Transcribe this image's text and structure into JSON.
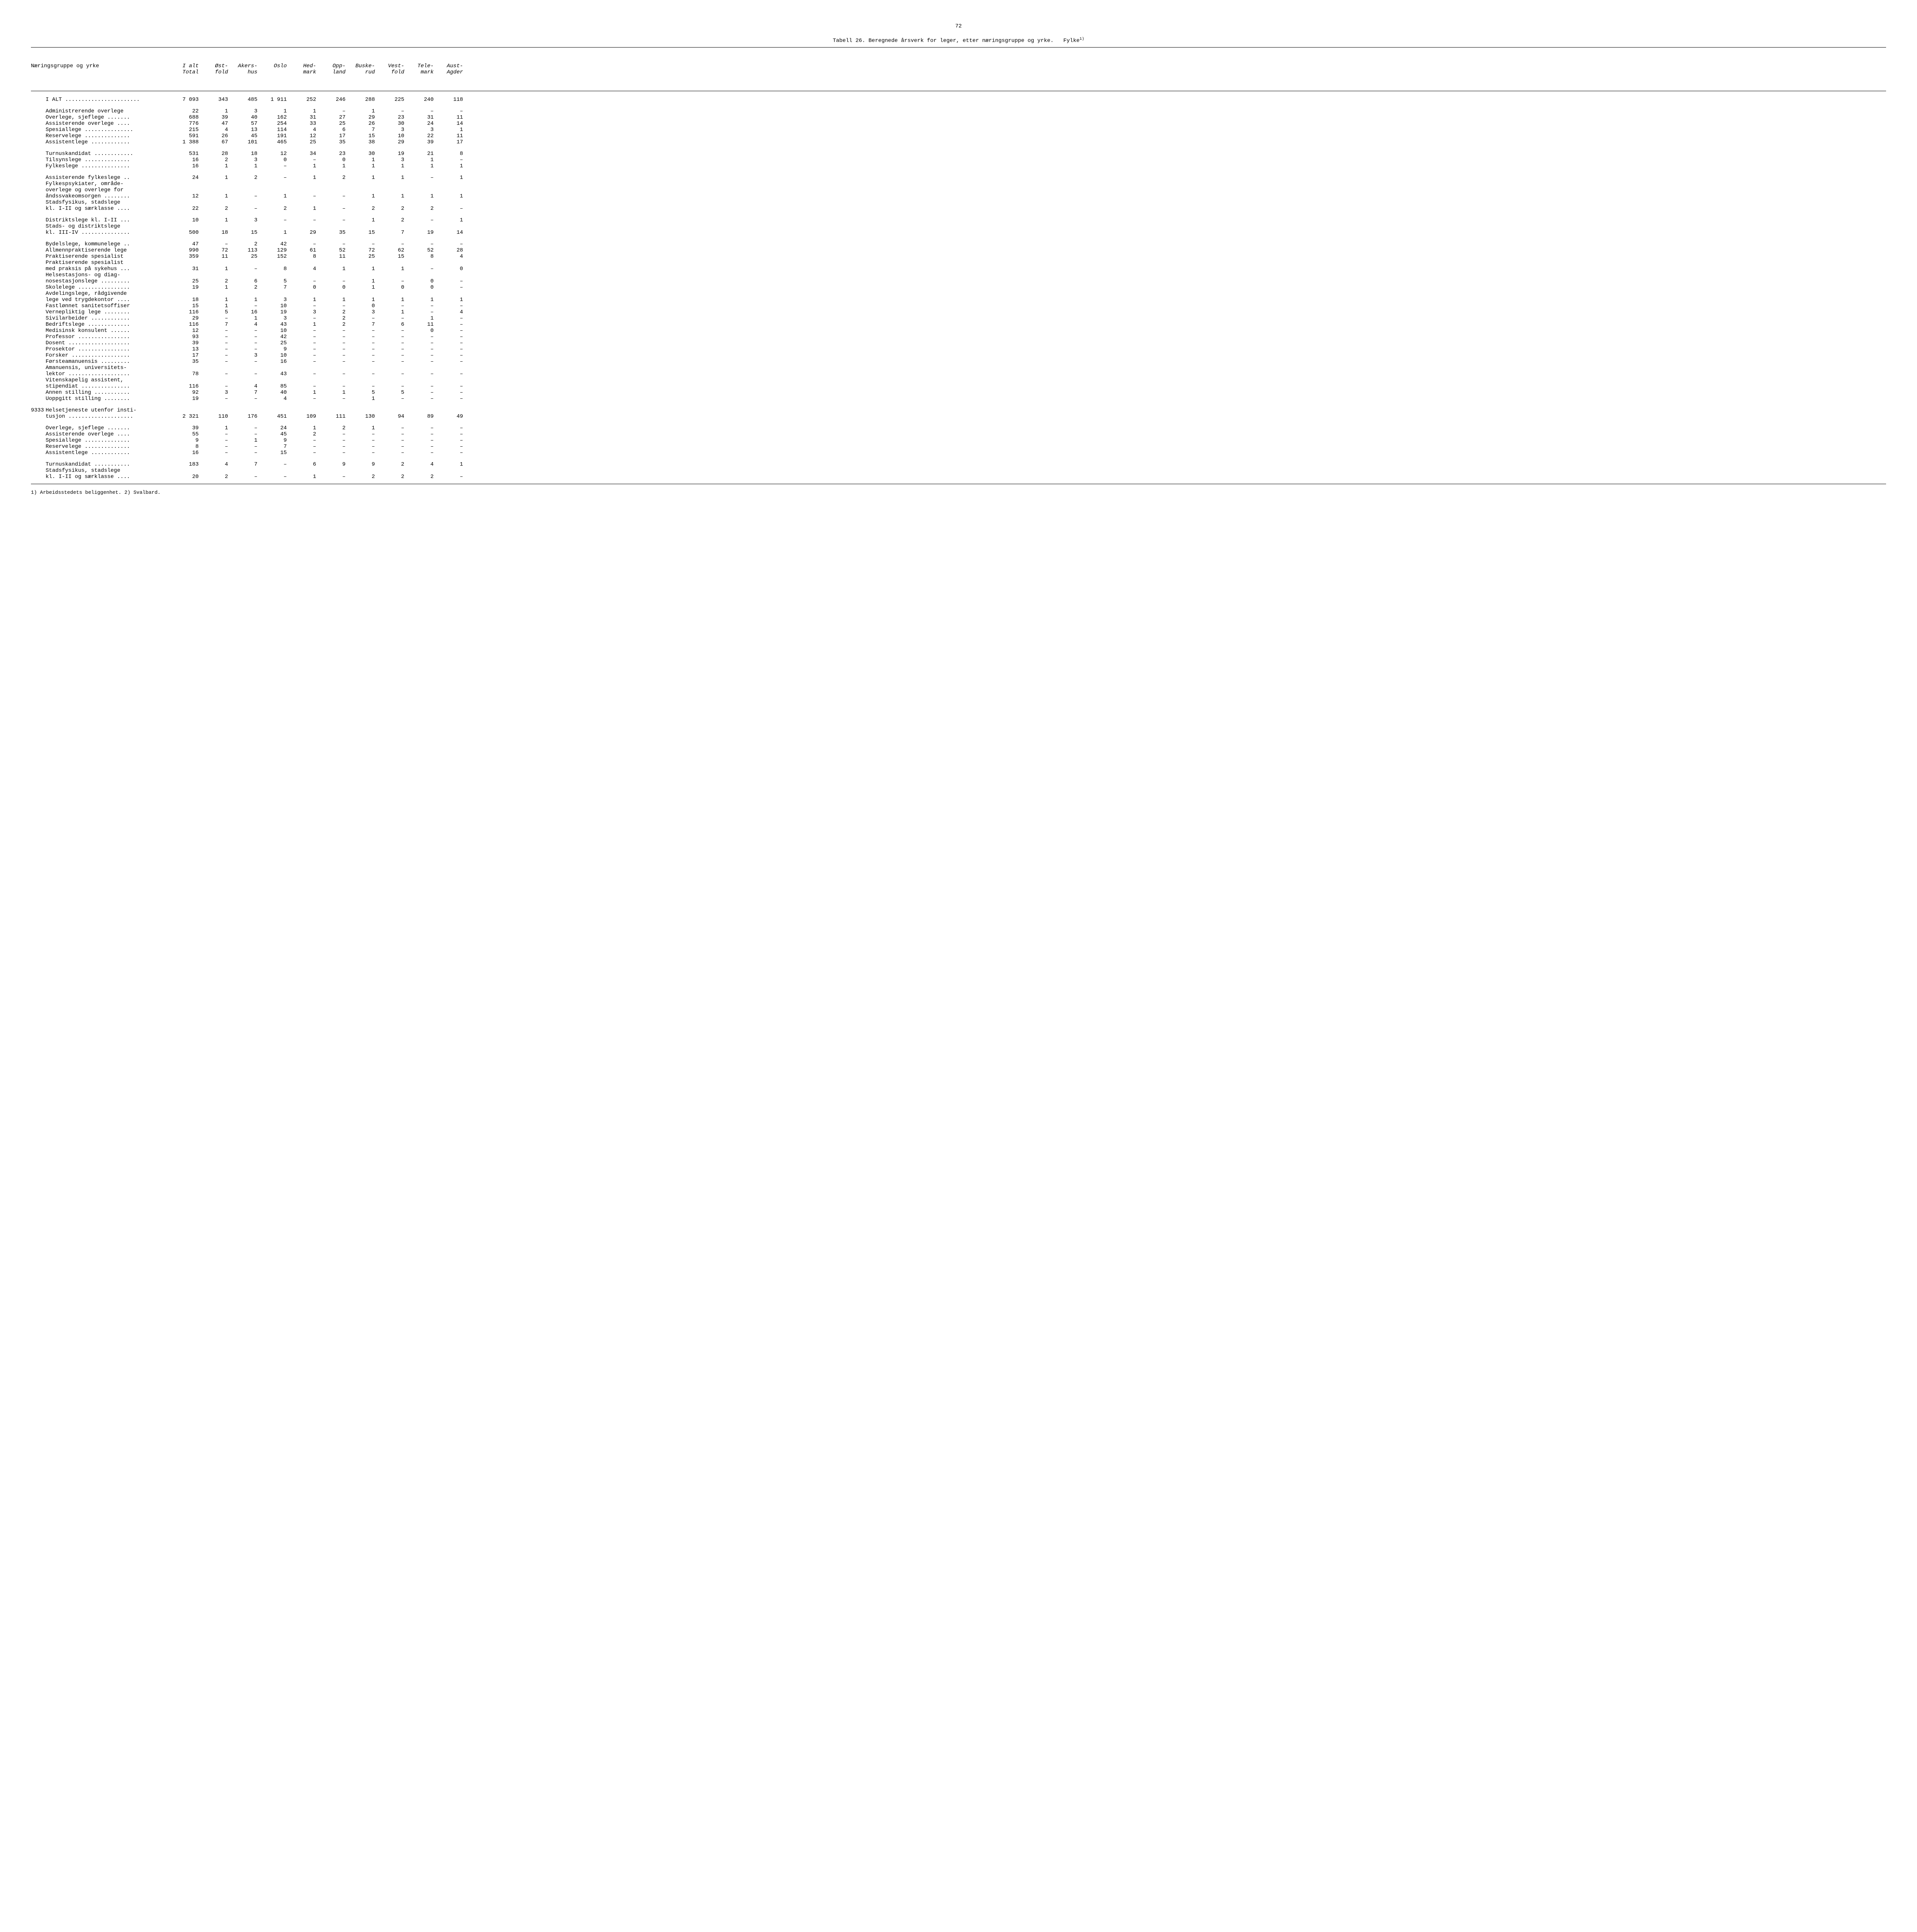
{
  "page_number": "72",
  "table_caption_prefix": "Tabell 26.",
  "table_caption": "Beregnede årsverk for leger, etter næringsgruppe og yrke.",
  "table_caption_suffix": "Fylke",
  "table_caption_sup": "1)",
  "head_label": "Næringsgruppe og yrke",
  "columns": [
    "I alt\nTotal",
    "Øst-\nfold",
    "Akers-\nhus",
    "Oslo",
    "Hed-\nmark",
    "Opp-\nland",
    "Buske-\nrud",
    "Vest-\nfold",
    "Tele-\nmark",
    "Aust-\nAgder"
  ],
  "footnote": "1)  Arbeidsstedets beliggenhet.  2)  Svalbard.",
  "rows": [
    {
      "type": "data",
      "code": "",
      "label": "I ALT .......................",
      "v": [
        "7 093",
        "343",
        "485",
        "1 911",
        "252",
        "246",
        "288",
        "225",
        "240",
        "118"
      ]
    },
    {
      "type": "spacer"
    },
    {
      "type": "data",
      "code": "",
      "label": "Administrerende overlege",
      "v": [
        "22",
        "1",
        "3",
        "1",
        "1",
        "–",
        "1",
        "–",
        "–",
        "–"
      ]
    },
    {
      "type": "data",
      "code": "",
      "label": "Overlege, sjeflege .......",
      "v": [
        "688",
        "39",
        "40",
        "162",
        "31",
        "27",
        "29",
        "23",
        "31",
        "11"
      ]
    },
    {
      "type": "data",
      "code": "",
      "label": "Assisterende overlege ....",
      "v": [
        "776",
        "47",
        "57",
        "254",
        "33",
        "25",
        "26",
        "30",
        "24",
        "14"
      ]
    },
    {
      "type": "data",
      "code": "",
      "label": "Spesiallege ...............",
      "v": [
        "215",
        "4",
        "13",
        "114",
        "4",
        "6",
        "7",
        "3",
        "3",
        "1"
      ]
    },
    {
      "type": "data",
      "code": "",
      "label": "Reservelege ..............",
      "v": [
        "591",
        "26",
        "45",
        "191",
        "12",
        "17",
        "15",
        "10",
        "22",
        "11"
      ]
    },
    {
      "type": "data",
      "code": "",
      "label": "Assistentlege ............",
      "v": [
        "1 388",
        "67",
        "101",
        "465",
        "25",
        "35",
        "38",
        "29",
        "39",
        "17"
      ]
    },
    {
      "type": "spacer"
    },
    {
      "type": "data",
      "code": "",
      "label": "Turnuskandidat ............",
      "v": [
        "531",
        "28",
        "18",
        "12",
        "34",
        "23",
        "30",
        "19",
        "21",
        "8"
      ]
    },
    {
      "type": "data",
      "code": "",
      "label": "Tilsynslege ..............",
      "v": [
        "16",
        "2",
        "3",
        "0",
        "–",
        "0",
        "1",
        "3",
        "1",
        "–"
      ]
    },
    {
      "type": "data",
      "code": "",
      "label": "Fylkeslege ...............",
      "v": [
        "16",
        "1",
        "1",
        "–",
        "1",
        "1",
        "1",
        "1",
        "1",
        "1"
      ]
    },
    {
      "type": "spacer"
    },
    {
      "type": "data",
      "code": "",
      "label": "Assisterende fylkeslege ..",
      "v": [
        "24",
        "1",
        "2",
        "–",
        "1",
        "2",
        "1",
        "1",
        "–",
        "1"
      ]
    },
    {
      "type": "label",
      "code": "",
      "label": "Fylkespsykiater, område-"
    },
    {
      "type": "label",
      "code": "",
      "label": "overlege og overlege for"
    },
    {
      "type": "data",
      "code": "",
      "label": "åndssvakeomsorgen ........",
      "v": [
        "12",
        "1",
        "–",
        "1",
        "–",
        "–",
        "1",
        "1",
        "1",
        "1"
      ]
    },
    {
      "type": "label",
      "code": "",
      "label": "Stadsfysikus, stadslege"
    },
    {
      "type": "data",
      "code": "",
      "label": "kl. I-II og særklasse ....",
      "v": [
        "22",
        "2",
        "–",
        "2",
        "1",
        "–",
        "2",
        "2",
        "2",
        "–"
      ]
    },
    {
      "type": "spacer"
    },
    {
      "type": "data",
      "code": "",
      "label": "Distriktslege kl. I-II ...",
      "v": [
        "10",
        "1",
        "3",
        "–",
        "–",
        "–",
        "1",
        "2",
        "–",
        "1"
      ]
    },
    {
      "type": "label",
      "code": "",
      "label": "Stads- og distriktslege"
    },
    {
      "type": "data",
      "code": "",
      "label": "kl. III-IV ...............",
      "v": [
        "500",
        "18",
        "15",
        "1",
        "29",
        "35",
        "15",
        "7",
        "19",
        "14"
      ]
    },
    {
      "type": "spacer"
    },
    {
      "type": "data",
      "code": "",
      "label": "Bydelslege, kommunelege ..",
      "v": [
        "47",
        "–",
        "2",
        "42",
        "–",
        "–",
        "–",
        "–",
        "–",
        "–"
      ]
    },
    {
      "type": "data",
      "code": "",
      "label": "Allmennpraktiserende lege",
      "v": [
        "990",
        "72",
        "113",
        "129",
        "61",
        "52",
        "72",
        "62",
        "52",
        "28"
      ]
    },
    {
      "type": "data",
      "code": "",
      "label": "Praktiserende spesialist",
      "v": [
        "359",
        "11",
        "25",
        "152",
        "8",
        "11",
        "25",
        "15",
        "8",
        "4"
      ]
    },
    {
      "type": "label",
      "code": "",
      "label": "Praktiserende spesialist"
    },
    {
      "type": "data",
      "code": "",
      "label": "med praksis på sykehus ...",
      "v": [
        "31",
        "1",
        "–",
        "8",
        "4",
        "1",
        "1",
        "1",
        "–",
        "0"
      ]
    },
    {
      "type": "label",
      "code": "",
      "label": "Helsestasjons- og diag-"
    },
    {
      "type": "data",
      "code": "",
      "label": "nosestasjon­slege .........",
      "v": [
        "25",
        "2",
        "6",
        "5",
        "–",
        "–",
        "1",
        "–",
        "0",
        "–"
      ]
    },
    {
      "type": "data",
      "code": "",
      "label": "Skolelege ................",
      "v": [
        "19",
        "1",
        "2",
        "7",
        "0",
        "0",
        "1",
        "0",
        "0",
        "–"
      ]
    },
    {
      "type": "label",
      "code": "",
      "label": "Avdelingslege, rådgivende"
    },
    {
      "type": "data",
      "code": "",
      "label": "lege ved trygdekontor ....",
      "v": [
        "18",
        "1",
        "1",
        "3",
        "1",
        "1",
        "1",
        "1",
        "1",
        "1"
      ]
    },
    {
      "type": "data",
      "code": "",
      "label": "Fastlønnet sanitetsoffiser",
      "v": [
        "15",
        "1",
        "–",
        "10",
        "–",
        "–",
        "0",
        "–",
        "–",
        "–"
      ]
    },
    {
      "type": "data",
      "code": "",
      "label": "Vernepliktig lege ........",
      "v": [
        "116",
        "5",
        "16",
        "19",
        "3",
        "2",
        "3",
        "1",
        "–",
        "4"
      ]
    },
    {
      "type": "data",
      "code": "",
      "label": "Sivilarbeider ............",
      "v": [
        "29",
        "–",
        "1",
        "3",
        "–",
        "2",
        "–",
        "–",
        "1",
        "–"
      ]
    },
    {
      "type": "data",
      "code": "",
      "label": "Bedriftslege .............",
      "v": [
        "116",
        "7",
        "4",
        "43",
        "1",
        "2",
        "7",
        "6",
        "11",
        "–"
      ]
    },
    {
      "type": "data",
      "code": "",
      "label": "Medisinsk konsulent ......",
      "v": [
        "12",
        "–",
        "–",
        "10",
        "–",
        "–",
        "–",
        "–",
        "0",
        "–"
      ]
    },
    {
      "type": "data",
      "code": "",
      "label": "Professor ................",
      "v": [
        "93",
        "–",
        "–",
        "42",
        "–",
        "–",
        "–",
        "–",
        "–",
        "–"
      ]
    },
    {
      "type": "data",
      "code": "",
      "label": "Dosent ...................",
      "v": [
        "39",
        "–",
        "–",
        "25",
        "–",
        "–",
        "–",
        "–",
        "–",
        "–"
      ]
    },
    {
      "type": "data",
      "code": "",
      "label": "Prosektor ................",
      "v": [
        "13",
        "–",
        "–",
        "9",
        "–",
        "–",
        "–",
        "–",
        "–",
        "–"
      ]
    },
    {
      "type": "data",
      "code": "",
      "label": "Forsker ..................",
      "v": [
        "17",
        "–",
        "3",
        "10",
        "–",
        "–",
        "–",
        "–",
        "–",
        "–"
      ]
    },
    {
      "type": "data",
      "code": "",
      "label": "Førsteamanuensis .........",
      "v": [
        "35",
        "–",
        "–",
        "16",
        "–",
        "–",
        "–",
        "–",
        "–",
        "–"
      ]
    },
    {
      "type": "label",
      "code": "",
      "label": "Amanuensis, universitets-"
    },
    {
      "type": "data",
      "code": "",
      "label": "lektor ...................",
      "v": [
        "78",
        "–",
        "–",
        "43",
        "–",
        "–",
        "–",
        "–",
        "–",
        "–"
      ]
    },
    {
      "type": "label",
      "code": "",
      "label": "Vitenskapelig assistent,"
    },
    {
      "type": "data",
      "code": "",
      "label": "stipendiat ...............",
      "v": [
        "116",
        "–",
        "4",
        "85",
        "–",
        "–",
        "–",
        "–",
        "–",
        "–"
      ]
    },
    {
      "type": "data",
      "code": "",
      "label": "Annen stilling ...........",
      "v": [
        "92",
        "3",
        "7",
        "40",
        "1",
        "1",
        "5",
        "5",
        "–",
        "–"
      ]
    },
    {
      "type": "data",
      "code": "",
      "label": "Uoppgitt stilling ........",
      "v": [
        "19",
        "–",
        "–",
        "4",
        "–",
        "–",
        "1",
        "–",
        "–",
        "–"
      ]
    },
    {
      "type": "spacer"
    },
    {
      "type": "label",
      "code": "9333",
      "label": "Helsetjeneste utenfor insti-"
    },
    {
      "type": "data",
      "code": "",
      "label": "tusjon ....................",
      "v": [
        "2 321",
        "110",
        "176",
        "451",
        "109",
        "111",
        "130",
        "94",
        "89",
        "49"
      ]
    },
    {
      "type": "spacer"
    },
    {
      "type": "data",
      "code": "",
      "label": "Overlege, sjeflege .......",
      "v": [
        "39",
        "1",
        "–",
        "24",
        "1",
        "2",
        "1",
        "–",
        "–",
        "–"
      ]
    },
    {
      "type": "data",
      "code": "",
      "label": "Assisterende overlege ....",
      "v": [
        "55",
        "–",
        "–",
        "45",
        "2",
        "–",
        "–",
        "–",
        "–",
        "–"
      ]
    },
    {
      "type": "data",
      "code": "",
      "label": "Spesiallege ..............",
      "v": [
        "9",
        "–",
        "1",
        "9",
        "–",
        "–",
        "–",
        "–",
        "–",
        "–"
      ]
    },
    {
      "type": "data",
      "code": "",
      "label": "Reservelege ..............",
      "v": [
        "8",
        "–",
        "–",
        "7",
        "–",
        "–",
        "–",
        "–",
        "–",
        "–"
      ]
    },
    {
      "type": "data",
      "code": "",
      "label": "Assistentlege ............",
      "v": [
        "16",
        "–",
        "–",
        "15",
        "–",
        "–",
        "–",
        "–",
        "–",
        "–"
      ]
    },
    {
      "type": "spacer"
    },
    {
      "type": "data",
      "code": "",
      "label": "Turnuskandidat ...........",
      "v": [
        "183",
        "4",
        "7",
        "–",
        "6",
        "9",
        "9",
        "2",
        "4",
        "1"
      ]
    },
    {
      "type": "label",
      "code": "",
      "label": "Stadsfysikus, stadslege"
    },
    {
      "type": "data",
      "code": "",
      "label": "kl. I-II og særklasse ....",
      "v": [
        "20",
        "2",
        "–",
        "–",
        "1",
        "–",
        "2",
        "2",
        "2",
        "–"
      ]
    }
  ]
}
